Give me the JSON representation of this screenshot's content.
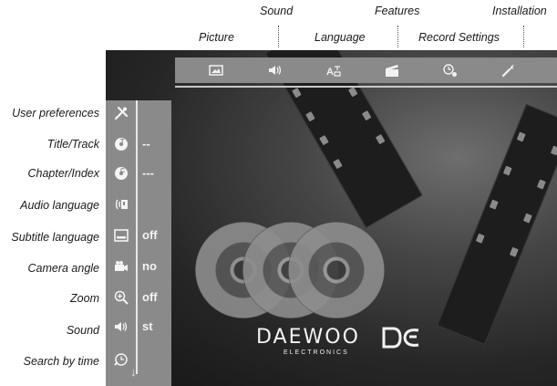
{
  "top_labels": {
    "sound": "Sound",
    "features": "Features",
    "installation": "Installation",
    "picture": "Picture",
    "language": "Language",
    "record_settings": "Record Settings"
  },
  "menu_bar": {
    "items": [
      {
        "name": "picture",
        "icon": "picture-icon"
      },
      {
        "name": "sound",
        "icon": "speaker-icon"
      },
      {
        "name": "language",
        "icon": "language-icon"
      },
      {
        "name": "features",
        "icon": "clapperboard-icon"
      },
      {
        "name": "record-settings",
        "icon": "record-timer-icon"
      },
      {
        "name": "installation",
        "icon": "wrench-icon"
      }
    ]
  },
  "sidebar": {
    "items": [
      {
        "label": "User preferences",
        "icon": "tools-icon",
        "value": ""
      },
      {
        "label": "Title/Track",
        "icon": "title-disc-icon",
        "value": "--"
      },
      {
        "label": "Chapter/Index",
        "icon": "chapter-disc-icon",
        "value": "---"
      },
      {
        "label": "Audio language",
        "icon": "audio-language-icon",
        "value": ""
      },
      {
        "label": "Subtitle language",
        "icon": "subtitle-icon",
        "value": "off"
      },
      {
        "label": "Camera angle",
        "icon": "camera-icon",
        "value": "no"
      },
      {
        "label": "Zoom",
        "icon": "zoom-icon",
        "value": "off"
      },
      {
        "label": "Sound",
        "icon": "speaker-icon",
        "value": "st"
      },
      {
        "label": "Search by time",
        "icon": "search-time-icon",
        "value": ""
      }
    ]
  },
  "logo": {
    "brand": "DAEWOO",
    "sub": "ELECTRONICS"
  }
}
